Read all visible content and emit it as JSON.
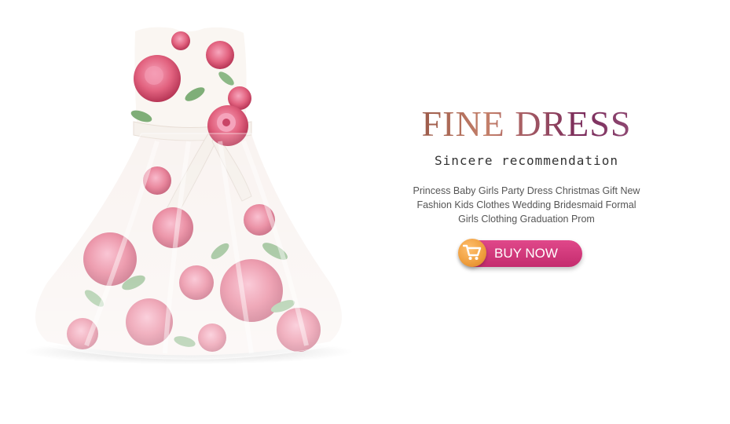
{
  "headline": "FINE DRESS",
  "subheadline": "Sincere recommendation",
  "description": "Princess Baby Girls Party Dress Christmas Gift New Fashion Kids Clothes Wedding Bridesmaid Formal Girls Clothing Graduation Prom",
  "buy_button": {
    "label": "BUY NOW",
    "icon": "shopping-cart-icon"
  },
  "colors": {
    "button": "#d43a7c",
    "cart_circle": "#f0a040",
    "headline_gradient": [
      "#8a4a3c",
      "#7a2a5a"
    ],
    "rose": "#e86a8e",
    "leaf": "#7fae78"
  }
}
